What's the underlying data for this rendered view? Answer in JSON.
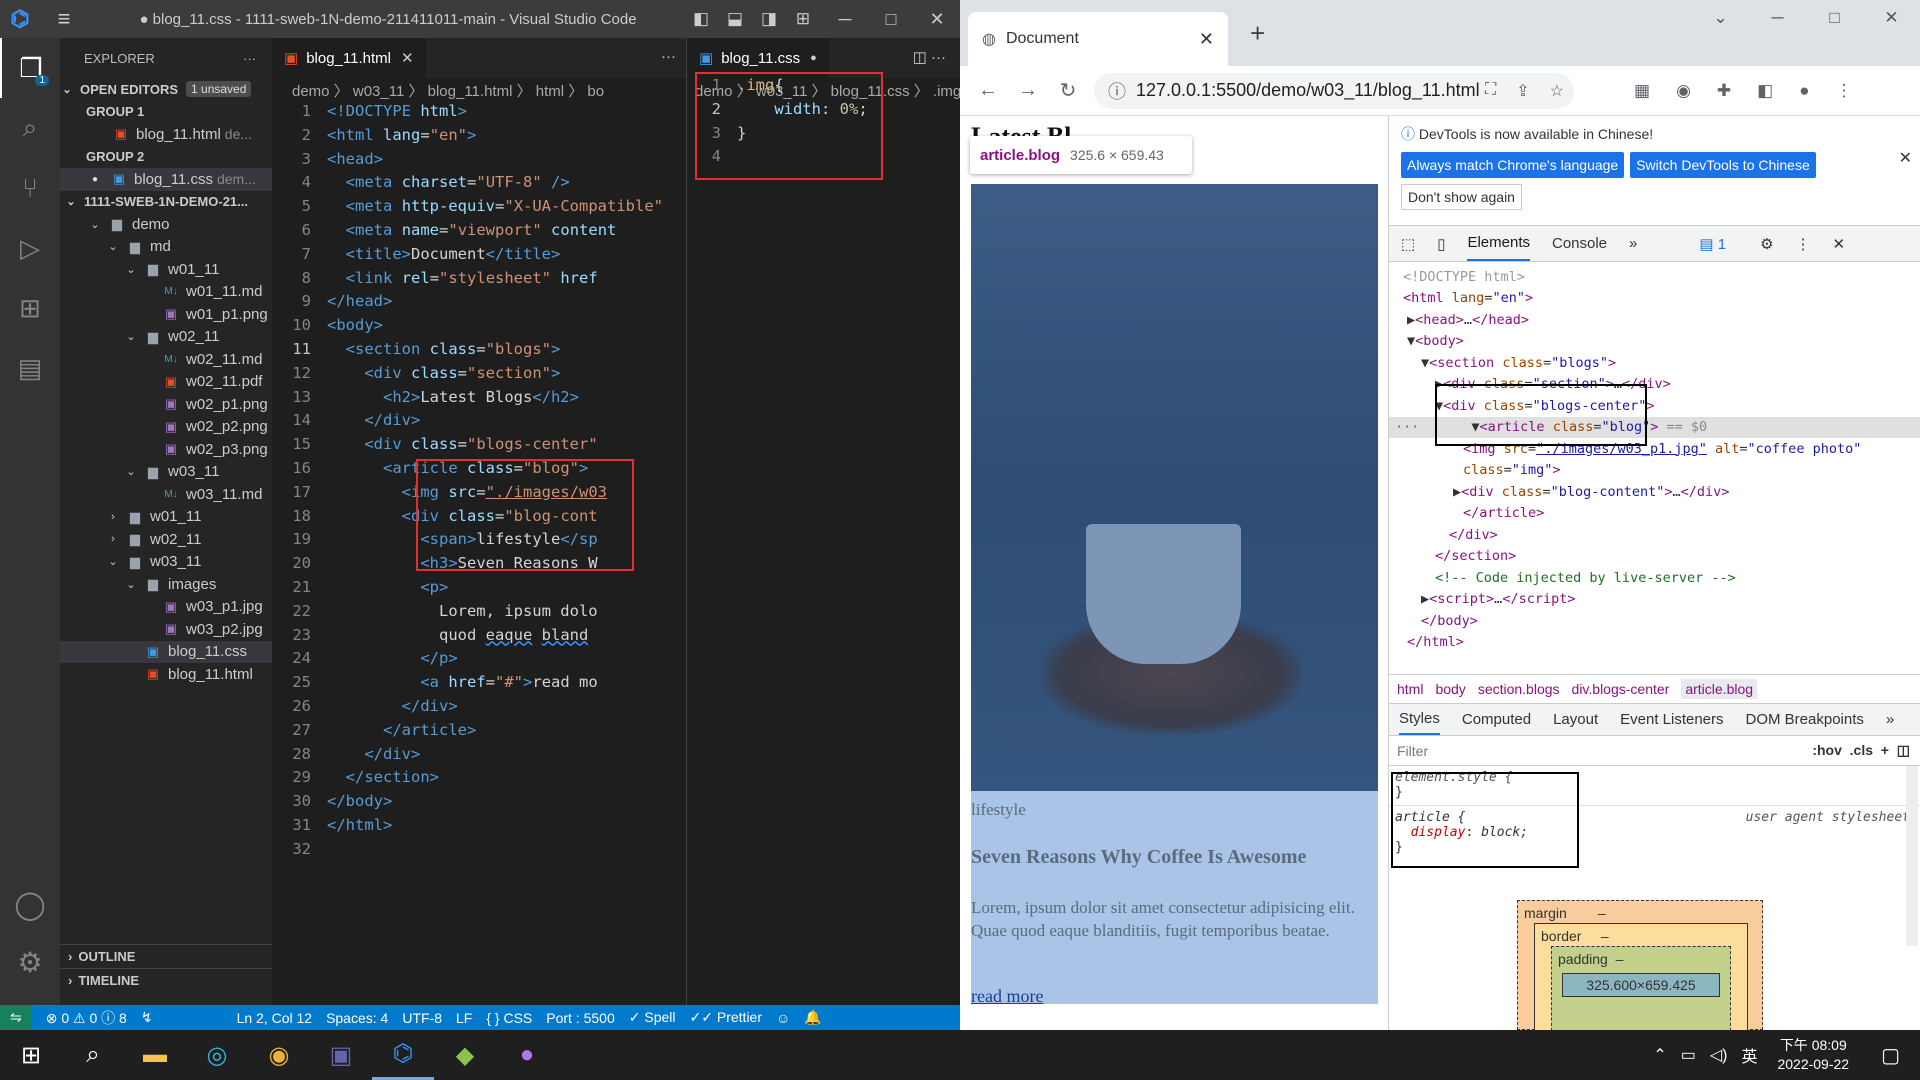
{
  "vscode": {
    "title": "● blog_11.css - 1111-sweb-1N-demo-211411011-main - Visual Studio Code",
    "explorer_label": "EXPLORER",
    "open_editors": "OPEN EDITORS",
    "unsaved_badge": "1 unsaved",
    "group1": "GROUP 1",
    "group1_file": "blog_11.html",
    "group1_dim": "de...",
    "group2": "GROUP 2",
    "group2_file": "blog_11.css",
    "group2_dim": "dem...",
    "project": "1111-SWEB-1N-DEMO-21...",
    "tree": [
      {
        "indent": 1,
        "kind": "folder-open",
        "label": "demo"
      },
      {
        "indent": 2,
        "kind": "folder-open",
        "label": "md"
      },
      {
        "indent": 3,
        "kind": "folder-open",
        "label": "w01_11"
      },
      {
        "indent": 4,
        "kind": "md",
        "label": "w01_11.md"
      },
      {
        "indent": 4,
        "kind": "img",
        "label": "w01_p1.png"
      },
      {
        "indent": 3,
        "kind": "folder-open",
        "label": "w02_11"
      },
      {
        "indent": 4,
        "kind": "md",
        "label": "w02_11.md"
      },
      {
        "indent": 4,
        "kind": "pdf",
        "label": "w02_11.pdf"
      },
      {
        "indent": 4,
        "kind": "img",
        "label": "w02_p1.png"
      },
      {
        "indent": 4,
        "kind": "img",
        "label": "w02_p2.png"
      },
      {
        "indent": 4,
        "kind": "img",
        "label": "w02_p3.png"
      },
      {
        "indent": 3,
        "kind": "folder-open",
        "label": "w03_11"
      },
      {
        "indent": 4,
        "kind": "md",
        "label": "w03_11.md"
      },
      {
        "indent": 2,
        "kind": "folder",
        "label": "w01_11"
      },
      {
        "indent": 2,
        "kind": "folder",
        "label": "w02_11"
      },
      {
        "indent": 2,
        "kind": "folder-open",
        "label": "w03_11"
      },
      {
        "indent": 3,
        "kind": "folder-open",
        "label": "images"
      },
      {
        "indent": 4,
        "kind": "img",
        "label": "w03_p1.jpg"
      },
      {
        "indent": 4,
        "kind": "img",
        "label": "w03_p2.jpg"
      },
      {
        "indent": 3,
        "kind": "css",
        "label": "blog_11.css",
        "selected": true
      },
      {
        "indent": 3,
        "kind": "html",
        "label": "blog_11.html"
      }
    ],
    "outline": "OUTLINE",
    "timeline": "TIMELINE",
    "editor1": {
      "tab": "blog_11.html",
      "breadcrumb": "demo 〉 w03_11 〉 blog_11.html 〉 html 〉 bo",
      "current_line": 11
    },
    "editor2": {
      "tab": "blog_11.css",
      "breadcrumb": "demo 〉 w03_11 〉 blog_11.css 〉 .img",
      "current_line": 2
    },
    "status": {
      "branch_icon": "remote",
      "problems": "⊗ 0 ⚠ 0 ⓘ 8",
      "position": "Ln 2, Col 12",
      "spaces": "Spaces: 4",
      "encoding": "UTF-8",
      "eol": "LF",
      "language": "{ } CSS",
      "port": "Port : 5500",
      "spell": "✓ Spell",
      "prettier": "✓✓ Prettier"
    }
  },
  "browser": {
    "tab_title": "Document",
    "url": "127.0.0.1:5500/demo/w03_11/blog_11.html",
    "tooltip_tag": "article.blog",
    "tooltip_size": "325.6 × 659.43",
    "heading_partial": "Latest Bl",
    "category": "lifestyle",
    "post_title": "Seven Reasons Why Coffee Is Awesome",
    "post_text": "Lorem, ipsum dolor sit amet consectetur adipisicing elit. Quae quod eaque blanditiis, fugit temporibus beatae.",
    "read_more": "read more"
  },
  "devtools": {
    "info": "DevTools is now available in Chinese!",
    "btn_match": "Always match Chrome's language",
    "btn_switch": "Switch DevTools to Chinese",
    "btn_dont": "Don't show again",
    "tab_elements": "Elements",
    "tab_console": "Console",
    "issues_count": "1",
    "crumbs": [
      "html",
      "body",
      "section.blogs",
      "div.blogs-center",
      "article.blog"
    ],
    "style_tabs": [
      "Styles",
      "Computed",
      "Layout",
      "Event Listeners",
      "DOM Breakpoints"
    ],
    "filter": "Filter",
    "hov": ":hov",
    "cls": ".cls",
    "element_style": "element.style {",
    "rule_selector": "article {",
    "rule_prop": "display",
    "rule_val": "block;",
    "rule_source": "user agent stylesheet",
    "box_margin": "margin",
    "box_border": "border",
    "box_padding": "padding",
    "box_dash": "–",
    "box_size": "325.600×659.425"
  },
  "taskbar": {
    "time": "下午 08:09",
    "date": "2022-09-22",
    "ime": "英"
  }
}
